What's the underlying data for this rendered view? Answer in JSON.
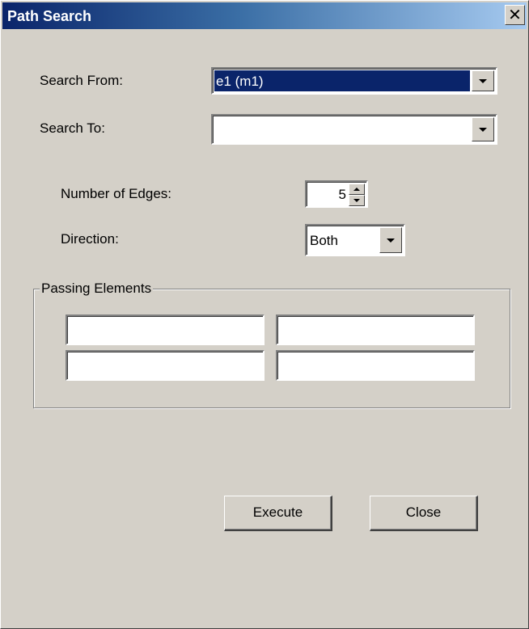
{
  "window": {
    "title": "Path Search",
    "close_glyph": "✕"
  },
  "form": {
    "search_from": {
      "label": "Search From:",
      "value": "e1 (m1)"
    },
    "search_to": {
      "label": "Search To:",
      "value": ""
    },
    "edges": {
      "label": "Number of Edges:",
      "value": "5"
    },
    "direction": {
      "label": "Direction:",
      "value": "Both"
    }
  },
  "passing_elements": {
    "label": "Passing Elements",
    "fields": [
      "",
      "",
      "",
      ""
    ]
  },
  "buttons": {
    "execute": "Execute",
    "close": "Close"
  },
  "icons": {
    "close": "close-icon",
    "dropdown": "chevron-down-icon",
    "spin_up": "chevron-up-icon",
    "spin_down": "chevron-down-icon"
  },
  "colors": {
    "titlebar_start": "#0a246a",
    "titlebar_end": "#a6caf0",
    "window_bg": "#d4d0c8",
    "selection": "#0a246a"
  }
}
